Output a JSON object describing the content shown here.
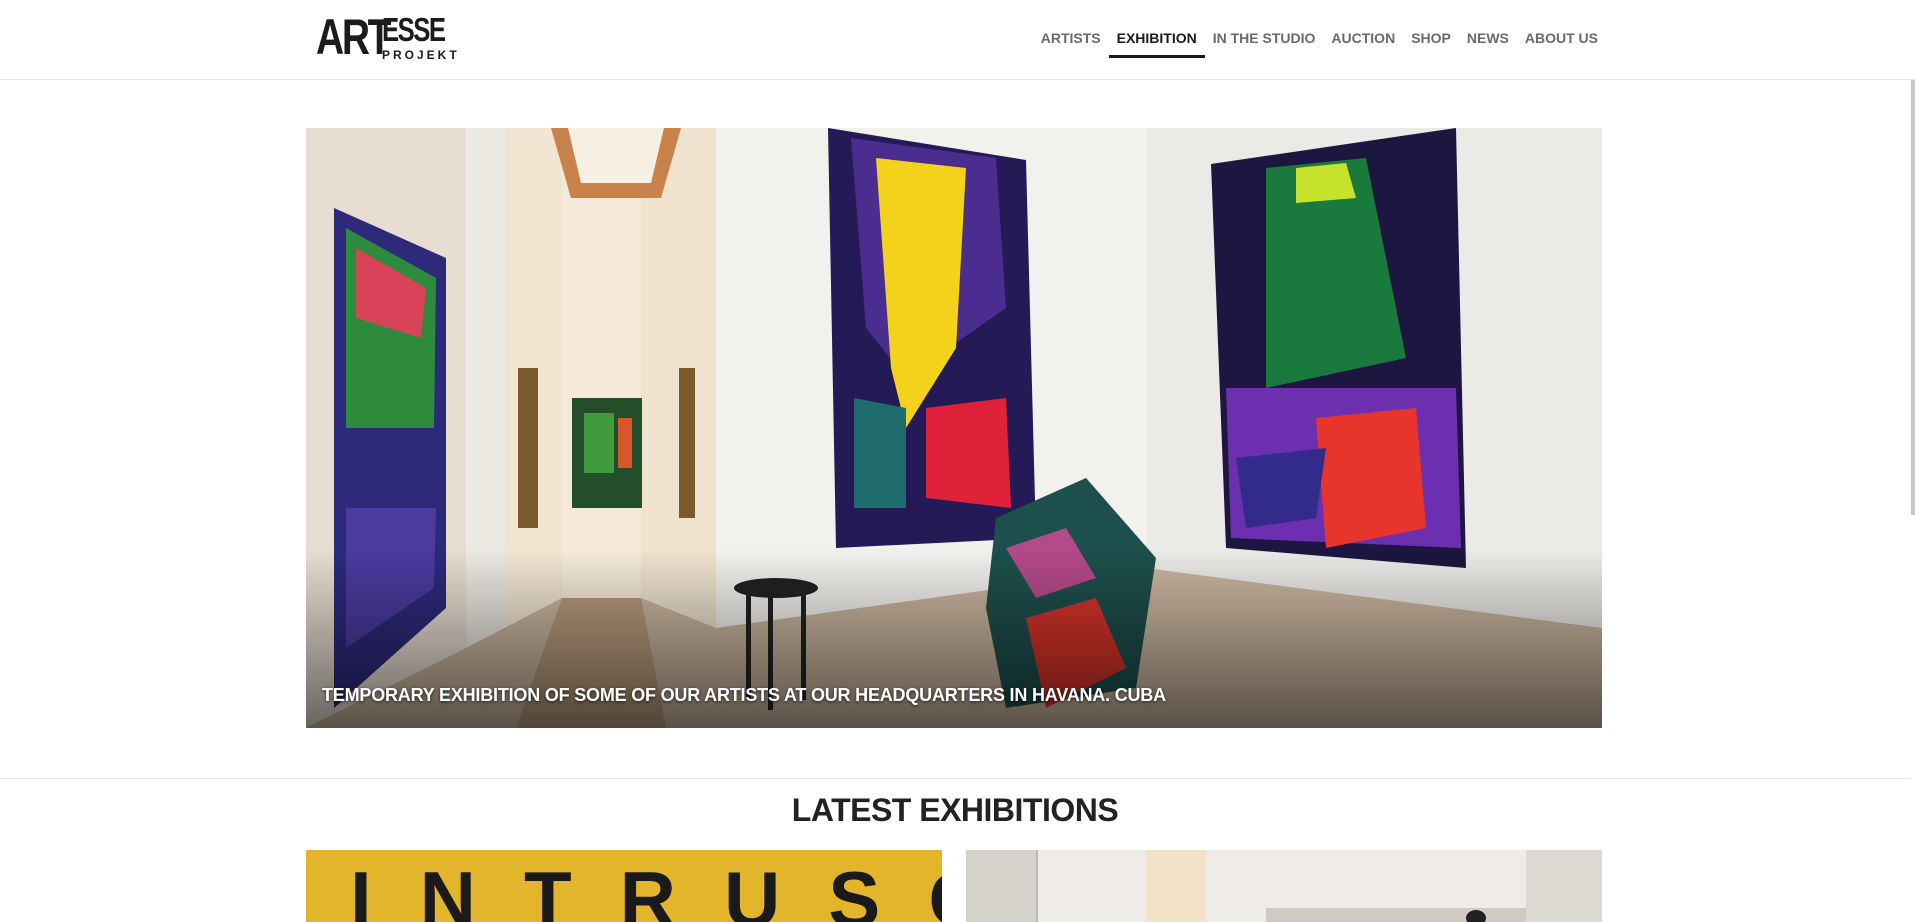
{
  "brand": {
    "logo_main": "ART",
    "logo_top": "ESSE",
    "logo_bottom": "PROJEKT"
  },
  "nav": {
    "items": [
      "ARTISTS",
      "EXHIBITION",
      "IN THE STUDIO",
      "AUCTION",
      "SHOP",
      "NEWS",
      "ABOUT US"
    ],
    "active": "EXHIBITION"
  },
  "hero": {
    "caption": "TEMPORARY EXHIBITION OF SOME OF OUR ARTISTS AT OUR HEADQUARTERS IN HAVANA. CUBA"
  },
  "latest": {
    "title": "LATEST EXHIBITIONS",
    "cards": [
      {
        "visible_text": "INTRUSO"
      },
      {
        "visible_text": ""
      }
    ]
  }
}
